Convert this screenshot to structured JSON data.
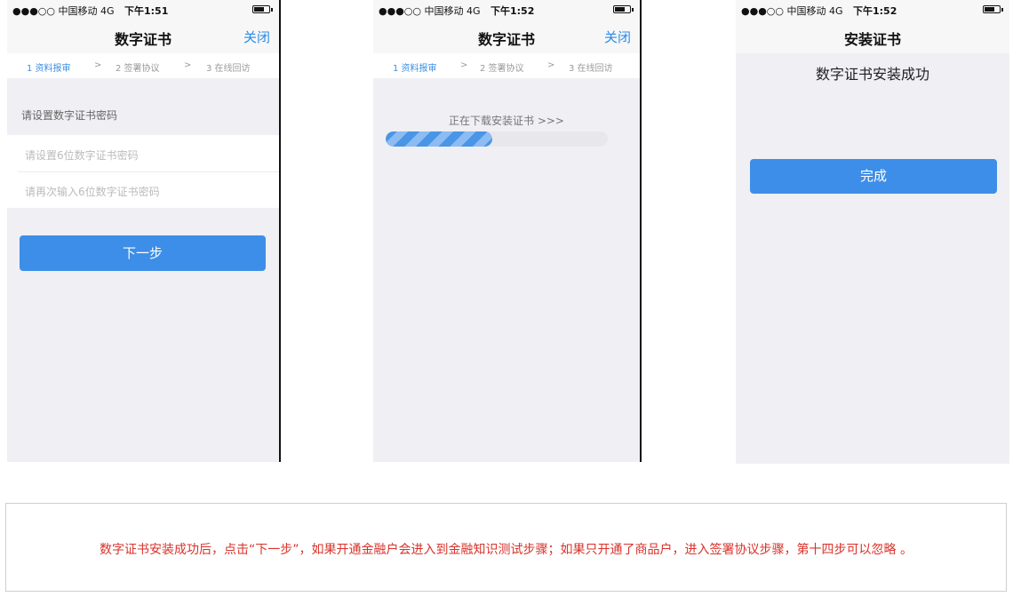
{
  "screens": [
    {
      "status": {
        "carrier": "●●●○○ 中国移动 4G",
        "time": "下午1:51"
      },
      "nav": {
        "title": "数字证书",
        "close": "关闭"
      },
      "steps": [
        "1 资料报审",
        ">",
        "2 签署协议",
        ">",
        "3 在线回访"
      ],
      "form": {
        "label": "请设置数字证书密码",
        "password_placeholder": "请设置6位数字证书密码",
        "confirm_placeholder": "请再次输入6位数字证书密码"
      },
      "button": "下一步"
    },
    {
      "status": {
        "carrier": "●●●○○ 中国移动 4G",
        "time": "下午1:52"
      },
      "nav": {
        "title": "数字证书",
        "close": "关闭"
      },
      "steps": [
        "1 资料报审",
        ">",
        "2 签署协议",
        ">",
        "3 在线回访"
      ],
      "download_text": "正在下载安装证书 >>>",
      "progress": 0.48
    },
    {
      "status": {
        "carrier": "●●●○○ 中国移动 4G",
        "time": "下午1:52"
      },
      "nav": {
        "title": "安装证书"
      },
      "success_text": "数字证书安装成功",
      "button": "完成"
    }
  ],
  "caption": "数字证书安装成功后，点击“下一步”，如果开通金融户会进入到金融知识测试步骤；如果只开通了商品户，进入签署协议步骤，第十四步可以忽略 。",
  "colors": {
    "accent": "#3d8ee8",
    "caption": "#d9322a",
    "screen_bg": "#efeff4"
  },
  "icons": [
    "battery-icon",
    "chevron-right-icon"
  ]
}
